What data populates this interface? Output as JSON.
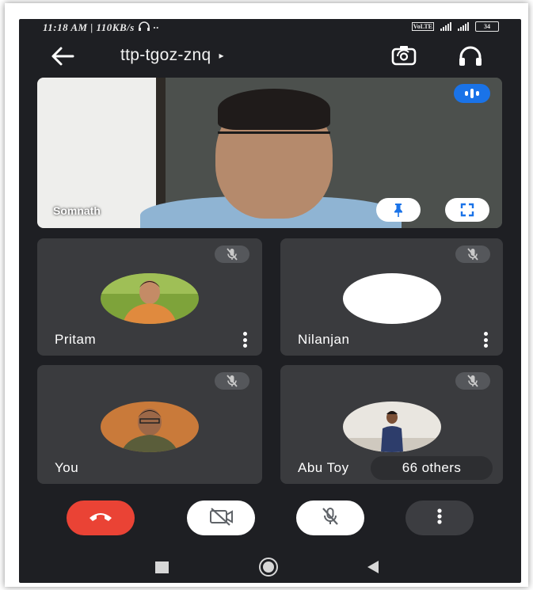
{
  "status_bar": {
    "time": "11:18 AM",
    "separator": "|",
    "speed": "110KB/s",
    "battery": "34"
  },
  "header": {
    "meeting_code": "ttp-tgoz-znq",
    "caret": "▸",
    "icons": [
      "back-arrow-icon",
      "switch-camera-icon",
      "headphones-icon"
    ]
  },
  "main_video": {
    "participant_name": "Somnath",
    "speaking": true,
    "buttons": [
      "pin-icon",
      "fullscreen-icon"
    ]
  },
  "tiles": [
    {
      "name": "Pritam",
      "muted": true
    },
    {
      "name": "Nilanjan",
      "muted": true
    },
    {
      "name": "You",
      "muted": true
    },
    {
      "name": "Abu Toy",
      "muted": true
    }
  ],
  "others_chip": "66 others",
  "controls": [
    "end-call-icon",
    "camera-off-icon",
    "mic-off-icon",
    "more-vert-icon"
  ],
  "colors": {
    "end_call": "#ea4335",
    "speaking_indicator": "#1a73e8",
    "background": "#1e1f23",
    "tile": "#3a3b3e"
  }
}
